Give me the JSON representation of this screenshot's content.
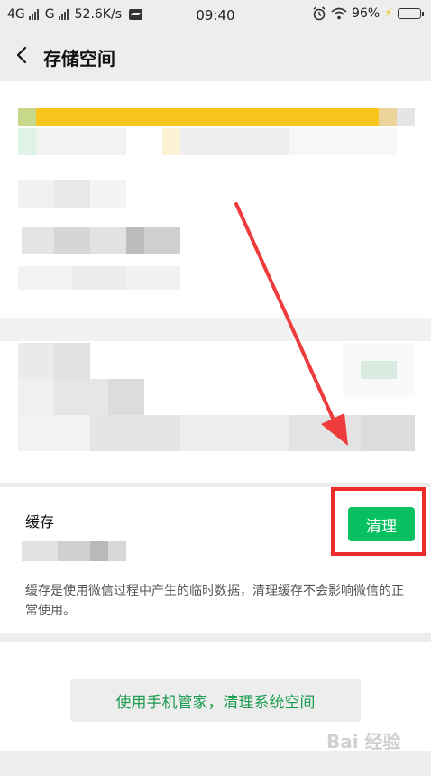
{
  "status_bar": {
    "network1": "4G",
    "network2": "G",
    "speed": "52.6K/s",
    "time": "09:40",
    "battery": "96%"
  },
  "header": {
    "title": "存储空间"
  },
  "cache": {
    "label": "缓存",
    "clean_label": "清理",
    "description": "缓存是使用微信过程中产生的临时数据，清理缓存不会影响微信的正常使用。"
  },
  "manager": {
    "label": "使用手机管家，清理系统空间"
  },
  "watermark": {
    "text": "Bai 经验"
  },
  "colors": {
    "accent": "#07c160",
    "highlight_box": "#ee2c2c",
    "storage_bar": "#f9c51c"
  }
}
